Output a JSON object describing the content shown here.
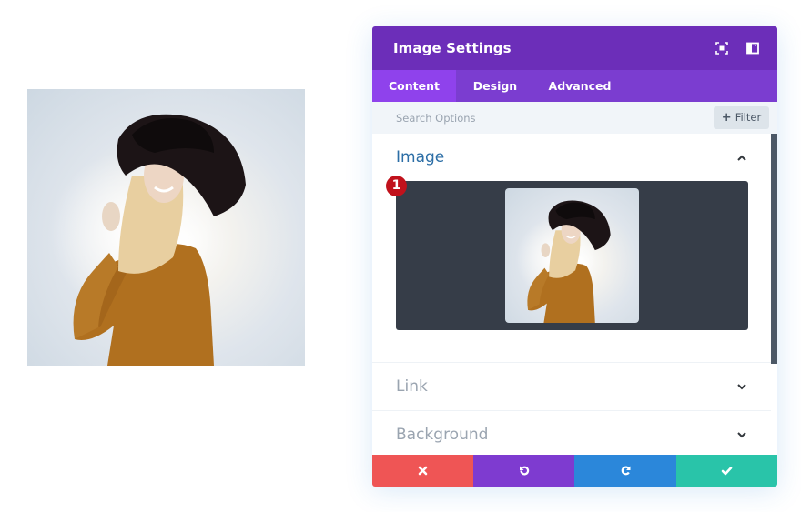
{
  "preview": {
    "image_alt": "Woman in black hat and orange sweater smiling against sky"
  },
  "panel": {
    "title": "Image Settings",
    "header_icons": [
      "expand-icon",
      "sidebar-toggle-icon"
    ],
    "tabs": [
      {
        "label": "Content",
        "active": true
      },
      {
        "label": "Design",
        "active": false
      },
      {
        "label": "Advanced",
        "active": false
      }
    ],
    "search": {
      "placeholder": "Search Options",
      "value": ""
    },
    "filter_button": {
      "icon": "+",
      "label": "Filter"
    },
    "sections": [
      {
        "title": "Image",
        "expanded": true
      },
      {
        "title": "Link",
        "expanded": false
      },
      {
        "title": "Background",
        "expanded": false
      }
    ],
    "upload": {
      "image_alt": "Selected image thumbnail"
    },
    "badge": "1",
    "footer": {
      "buttons": [
        {
          "name": "discard",
          "icon": "close-icon",
          "color": "#ef5555"
        },
        {
          "name": "undo",
          "icon": "undo-icon",
          "color": "#7e3bd0"
        },
        {
          "name": "redo",
          "icon": "redo-icon",
          "color": "#2b87da"
        },
        {
          "name": "save",
          "icon": "check-icon",
          "color": "#29c4a9"
        }
      ]
    }
  },
  "colors": {
    "header": "#6c2eb9",
    "tabs_bar": "#7b3dd0",
    "active_tab": "#8f42ec",
    "section_title_active": "#2c6ea6",
    "upload_bg": "#363d48",
    "badge": "#c1121c"
  }
}
